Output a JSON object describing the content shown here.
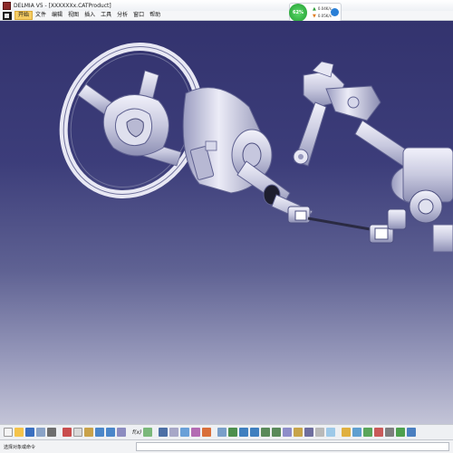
{
  "window": {
    "title": "DELMIA V5 - [XXXXXXx.CATProduct]"
  },
  "menu": {
    "items": [
      "开始",
      "文件",
      "编辑",
      "视图",
      "插入",
      "工具",
      "分析",
      "窗口",
      "帮助"
    ],
    "active_index": 0
  },
  "perf_widget": {
    "percent": "62%",
    "upload": "0.04K/s",
    "download": "0.05K/s"
  },
  "viewport": {
    "background_top": "#33336e",
    "background_bottom": "#c3c4d7"
  },
  "toolbar": {
    "formula_label": "f(x)"
  },
  "status": {
    "message": "选择对象或命令"
  }
}
